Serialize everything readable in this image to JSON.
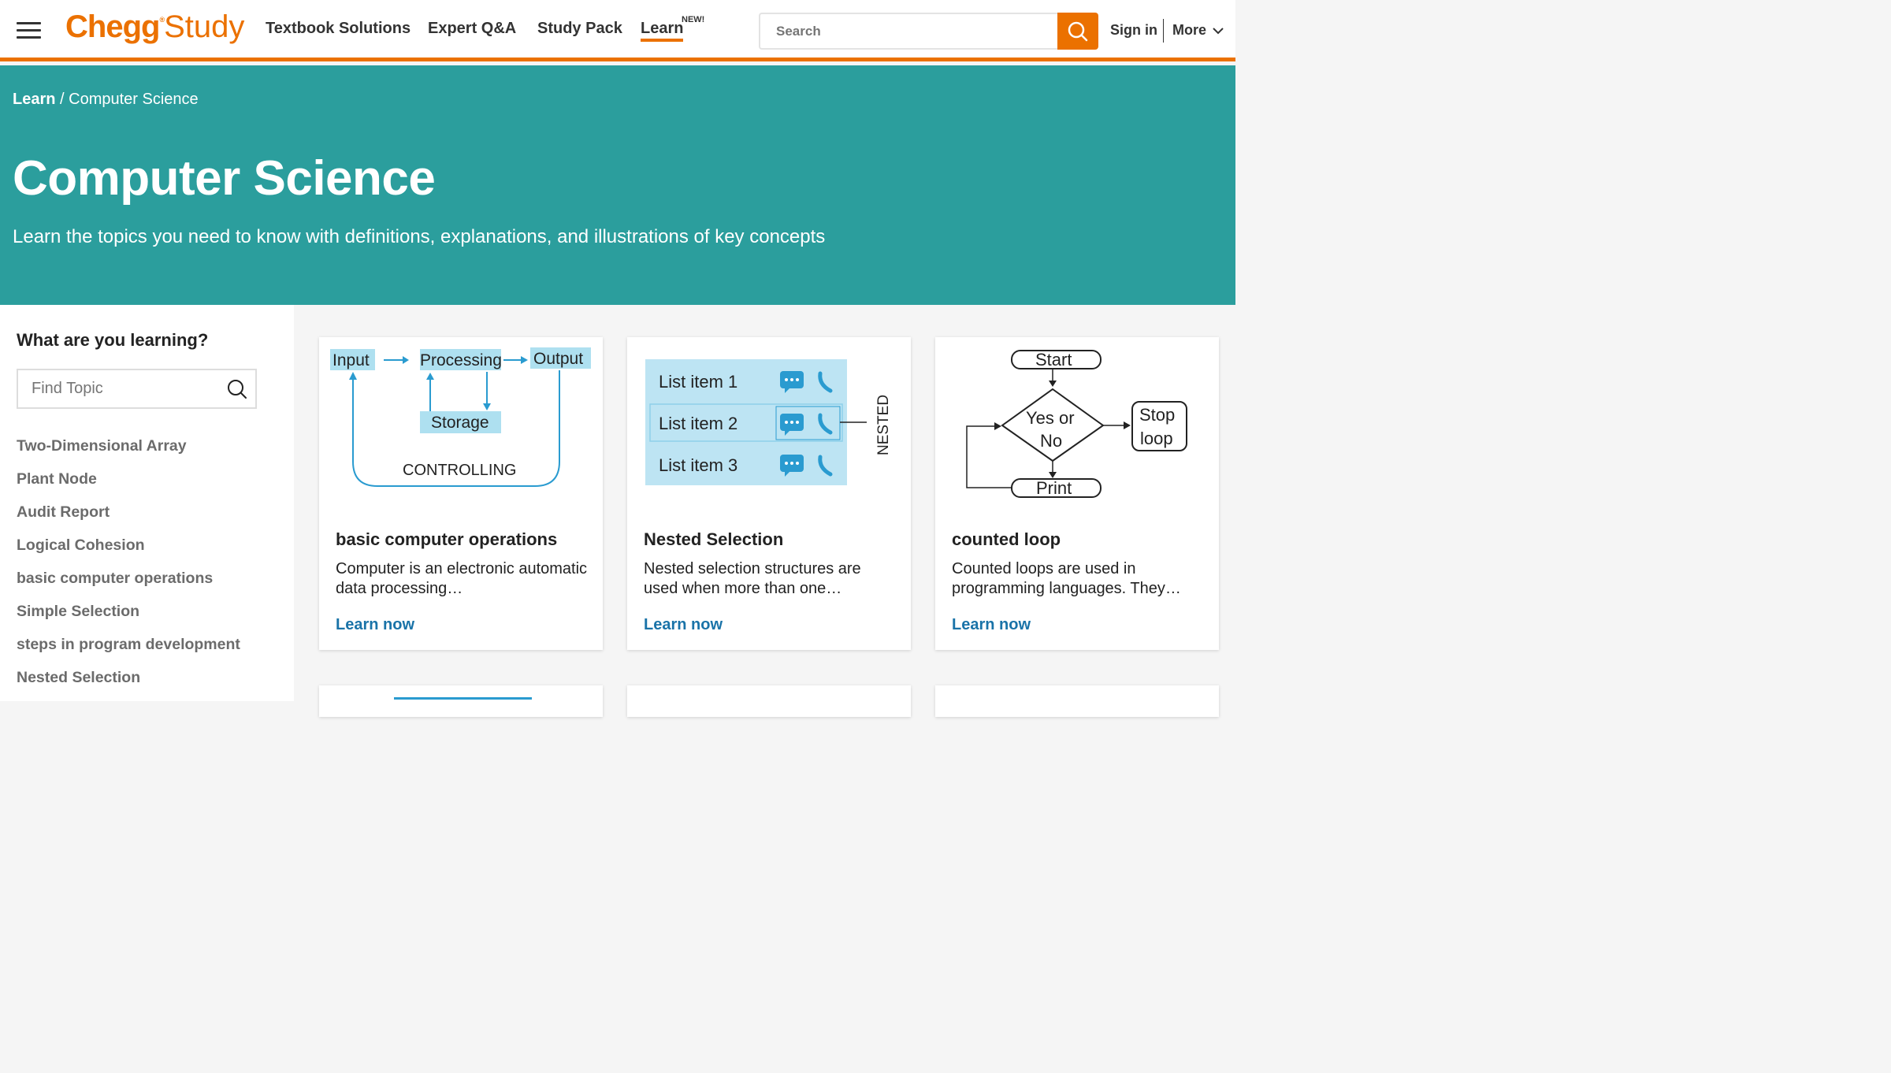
{
  "header": {
    "logo_chegg": "Chegg",
    "logo_study": "Study",
    "nav": {
      "textbook": "Textbook Solutions",
      "expert": "Expert Q&A",
      "studypack": "Study Pack",
      "learn": "Learn",
      "learn_badge": "NEW!"
    },
    "search_placeholder": "Search",
    "signin": "Sign in",
    "more": "More",
    "accent_color": "#eb7100"
  },
  "hero": {
    "breadcrumb_root": "Learn",
    "breadcrumb_sep": "/",
    "breadcrumb_current": "Computer Science",
    "title": "Computer Science",
    "subtitle": "Learn the topics you need to know with definitions, explanations, and illustrations of key concepts",
    "bg_color": "#2b9e9d"
  },
  "sidebar": {
    "heading": "What are you learning?",
    "find_placeholder": "Find Topic",
    "topics": [
      "Two-Dimensional Array",
      "Plant Node",
      "Audit Report",
      "Logical Cohesion",
      "basic computer operations",
      "Simple Selection",
      "steps in program development",
      "Nested Selection"
    ]
  },
  "cards": [
    {
      "title": "basic computer operations",
      "desc": "Computer is an electronic automatic data processing…",
      "link": "Learn now",
      "illus": {
        "input": "Input",
        "processing": "Processing",
        "output": "Output",
        "storage": "Storage",
        "controlling": "CONTROLLING"
      }
    },
    {
      "title": "Nested Selection",
      "desc": "Nested selection structures are used when more than one…",
      "link": "Learn now",
      "illus": {
        "item1": "List item 1",
        "item2": "List item 2",
        "item3": "List item 3",
        "nested": "NESTED"
      }
    },
    {
      "title": "counted loop",
      "desc": "Counted loops are used in programming languages. They…",
      "link": "Learn now",
      "illus": {
        "start": "Start",
        "yes_or": "Yes or",
        "no": "No",
        "stop": "Stop",
        "loop": "loop",
        "print": "Print"
      }
    }
  ]
}
